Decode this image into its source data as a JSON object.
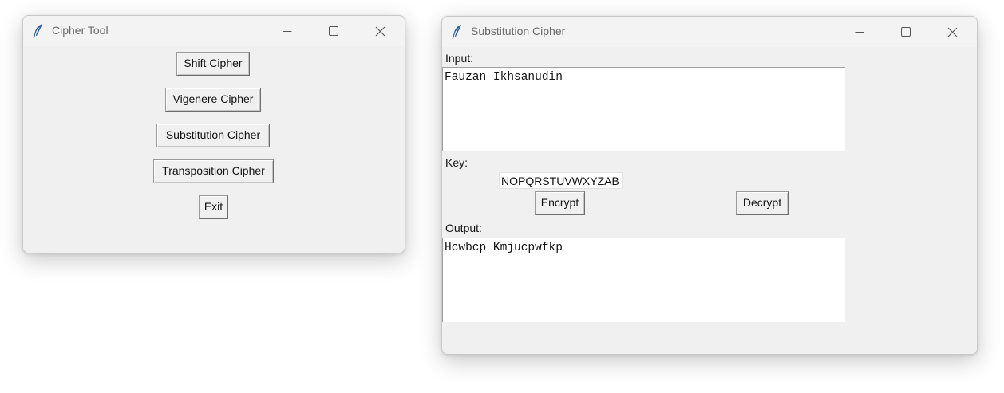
{
  "windows": {
    "cipher_tool": {
      "title": "Cipher Tool",
      "buttons": {
        "shift": "Shift Cipher",
        "vigenere": "Vigenere Cipher",
        "substitution": "Substitution Cipher",
        "transposition": "Transposition Cipher",
        "exit": "Exit"
      }
    },
    "substitution": {
      "title": "Substitution Cipher",
      "input_label": "Input:",
      "input_value": "Fauzan Ikhsanudin",
      "key_label": "Key:",
      "key_value": "NOPQRSTUVWXYZAB",
      "encrypt_label": "Encrypt",
      "decrypt_label": "Decrypt",
      "output_label": "Output:",
      "output_value": "Hcwbcp Kmjucpwfkp"
    }
  },
  "icons": {
    "app": "feather-icon",
    "minimize": "minimize-icon",
    "maximize": "maximize-icon",
    "close": "close-icon"
  },
  "colors": {
    "window_bg": "#f0f0f0",
    "titlebar_text": "#6b6b6b",
    "feather": "#2b5fa8"
  }
}
